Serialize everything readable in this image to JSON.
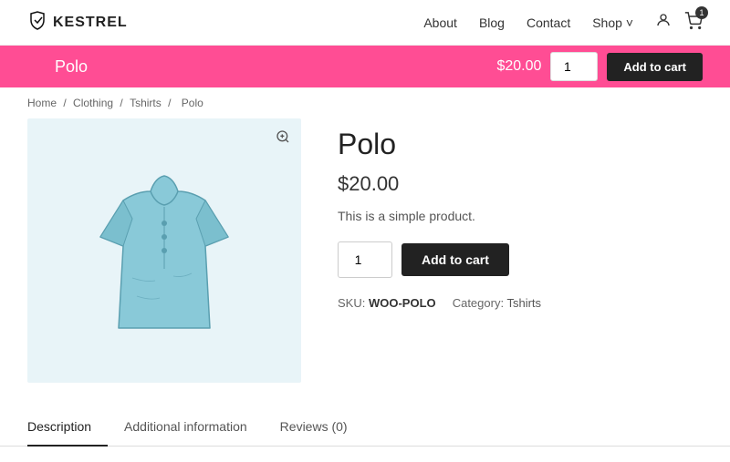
{
  "header": {
    "logo_text": "KESTREL",
    "nav": {
      "about": "About",
      "blog": "Blog",
      "contact": "Contact",
      "shop": "Shop"
    },
    "cart_count": "1"
  },
  "sticky_bar": {
    "title": "Polo",
    "price": "$20.00",
    "qty_value": "1",
    "add_to_cart_label": "Add to cart"
  },
  "breadcrumb": {
    "home": "Home",
    "clothing": "Clothing",
    "tshirts": "Tshirts",
    "current": "Polo"
  },
  "product": {
    "title": "Polo",
    "price": "$20.00",
    "description": "This is a simple product.",
    "qty_value": "1",
    "add_to_cart_label": "Add to cart",
    "sku_label": "SKU:",
    "sku_value": "WOO-POLO",
    "category_label": "Category:",
    "category_value": "Tshirts"
  },
  "tabs": {
    "description": "Description",
    "additional_info": "Additional information",
    "reviews": "Reviews (0)"
  }
}
